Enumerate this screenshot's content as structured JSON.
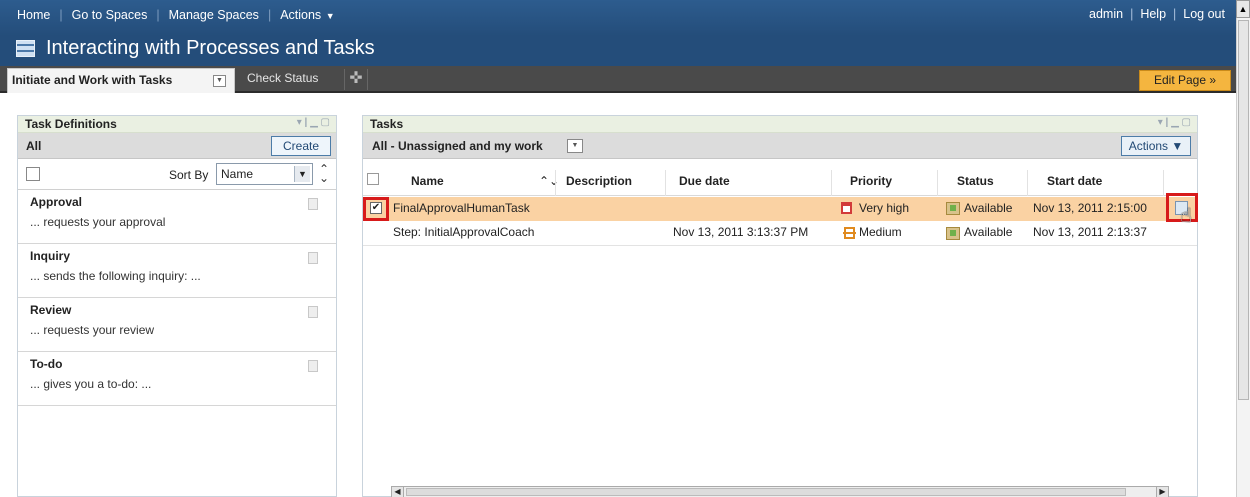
{
  "topnav": {
    "links": [
      "Home",
      "Go to Spaces",
      "Manage Spaces",
      "Actions"
    ],
    "user_links": [
      "admin",
      "Help",
      "Log out"
    ]
  },
  "title": "Interacting with Processes and Tasks",
  "tabs": {
    "active": "Initiate and Work with Tasks",
    "other": "Check Status",
    "edit_page": "Edit Page »"
  },
  "left_panel": {
    "title": "Task Definitions",
    "filter": "All",
    "create": "Create",
    "sort_by_label": "Sort By",
    "sort_value": "Name",
    "items": [
      {
        "name": "Approval",
        "desc": "... requests your approval"
      },
      {
        "name": "Inquiry",
        "desc": "... sends the following inquiry: ..."
      },
      {
        "name": "Review",
        "desc": "... requests your review"
      },
      {
        "name": "To-do",
        "desc": "... gives you a to-do: ..."
      }
    ]
  },
  "right_panel": {
    "title": "Tasks",
    "filter": "All - Unassigned and my work",
    "actions": "Actions",
    "columns": [
      "Name",
      "Description",
      "Due date",
      "Priority",
      "Status",
      "Start date"
    ],
    "rows": [
      {
        "name": "FinalApprovalHumanTask",
        "description": "",
        "due": "",
        "priority": "Very high",
        "status": "Available",
        "start": "Nov 13, 2011 2:15:00",
        "selected": true
      },
      {
        "name": "Step: InitialApprovalCoach",
        "description": "",
        "due": "Nov 13, 2011 3:13:37 PM",
        "priority": "Medium",
        "status": "Available",
        "start": "Nov 13, 2011 2:13:37",
        "selected": false
      }
    ]
  },
  "colors": {
    "nav_bg": "#2d5c8e",
    "selected_row": "#fad2a3",
    "highlight_box": "#d71a1a",
    "edit_page_bg": "#f4b53f"
  }
}
